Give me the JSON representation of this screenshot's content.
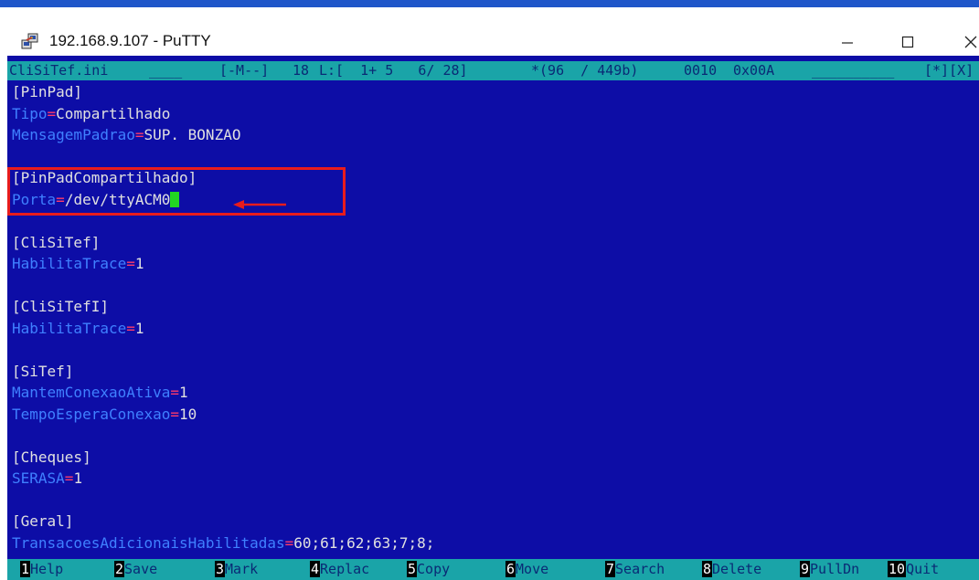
{
  "window": {
    "title": "192.168.9.107 - PuTTY",
    "controls": [
      "minimize",
      "maximize",
      "close"
    ]
  },
  "status": {
    "filename": "CliSiTef.ini",
    "filler1": "____",
    "mode": "[-M--]",
    "col": "18",
    "line_info": "L:[  1+ 5   6/ 28]",
    "char_info": "*(96  / 449b)",
    "code_dec": "0010",
    "code_hex": "0x00A",
    "filler2": "__________",
    "flags": "[*][X]"
  },
  "lines": [
    {
      "type": "section",
      "text": "[PinPad]"
    },
    {
      "type": "kv",
      "key": "Tipo",
      "value": "Compartilhado"
    },
    {
      "type": "kv",
      "key": "MensagemPadrao",
      "value": "SUP. BONZAO"
    },
    {
      "type": "blank"
    },
    {
      "type": "section",
      "text": "[PinPadCompartilhado]"
    },
    {
      "type": "kv",
      "key": "Porta",
      "value": "/dev/ttyACM0",
      "cursor": true
    },
    {
      "type": "blank"
    },
    {
      "type": "section",
      "text": "[CliSiTef]"
    },
    {
      "type": "kv",
      "key": "HabilitaTrace",
      "value": "1"
    },
    {
      "type": "blank"
    },
    {
      "type": "section",
      "text": "[CliSiTefI]"
    },
    {
      "type": "kv",
      "key": "HabilitaTrace",
      "value": "1"
    },
    {
      "type": "blank"
    },
    {
      "type": "section",
      "text": "[SiTef]"
    },
    {
      "type": "kv",
      "key": "MantemConexaoAtiva",
      "value": "1"
    },
    {
      "type": "kv",
      "key": "TempoEsperaConexao",
      "value": "10"
    },
    {
      "type": "blank"
    },
    {
      "type": "section",
      "text": "[Cheques]"
    },
    {
      "type": "kv",
      "key": "SERASA",
      "value": "1"
    },
    {
      "type": "blank"
    },
    {
      "type": "section",
      "text": "[Geral]"
    },
    {
      "type": "kv",
      "key": "TransacoesAdicionaisHabilitadas",
      "value": "60;61;62;63;7;8;"
    }
  ],
  "function_keys": [
    {
      "num": "1",
      "label": "Help"
    },
    {
      "num": "2",
      "label": "Save"
    },
    {
      "num": "3",
      "label": "Mark"
    },
    {
      "num": "4",
      "label": "Replac"
    },
    {
      "num": "5",
      "label": "Copy"
    },
    {
      "num": "6",
      "label": "Move"
    },
    {
      "num": "7",
      "label": "Search"
    },
    {
      "num": "8",
      "label": "Delete"
    },
    {
      "num": "9",
      "label": "PullDn"
    },
    {
      "num": "10",
      "label": "Quit"
    }
  ],
  "colors": {
    "terminal_bg": "#0d0da6",
    "bar_bg": "#1aa4a8",
    "key": "#3f80ff",
    "equals": "#ff3b6b",
    "value": "#e0e0e0",
    "cursor": "#22d622",
    "annotation": "#e81c1c"
  }
}
